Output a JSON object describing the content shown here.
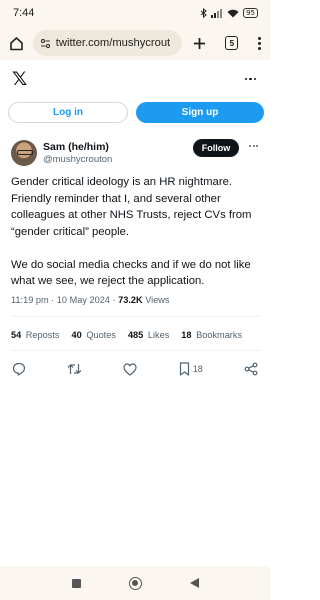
{
  "status_bar": {
    "time": "7:44",
    "battery": "95",
    "icons": [
      "bluetooth-icon",
      "signal-icon",
      "wifi-icon",
      "battery-icon"
    ]
  },
  "browser": {
    "url": "twitter.com/mushycrout",
    "tab_count": "5",
    "icons": [
      "home-icon",
      "site-settings-icon",
      "plus-icon",
      "tabs-icon",
      "more-vert-icon"
    ]
  },
  "header": {
    "logo": "𝕏"
  },
  "auth": {
    "login_label": "Log in",
    "signup_label": "Sign up"
  },
  "tweet": {
    "author_name": "Sam (he/him)",
    "author_handle": "@mushycrouton",
    "follow_label": "Follow",
    "paragraphs": [
      "Gender critical ideology is an HR nightmare. Friendly reminder that I, and several other colleagues at other NHS Trusts, reject CVs from “gender critical” people.",
      "We do social media checks and if we do not like what we see, we reject the application."
    ],
    "meta": {
      "time": "11:19 pm",
      "separator": " · ",
      "date": "10 May 2024",
      "views_count": "73.2K",
      "views_label": "Views"
    },
    "stats": {
      "reposts_count": "54",
      "reposts_label": "Reposts",
      "quotes_count": "40",
      "quotes_label": "Quotes",
      "likes_count": "485",
      "likes_label": "Likes",
      "bookmarks_count": "18",
      "bookmarks_label": "Bookmarks"
    },
    "actions": {
      "bookmark_count": "18"
    }
  },
  "colors": {
    "accent": "#1d9bf0",
    "text": "#0f1419",
    "muted": "#536471",
    "chrome": "#fbf7f0"
  }
}
